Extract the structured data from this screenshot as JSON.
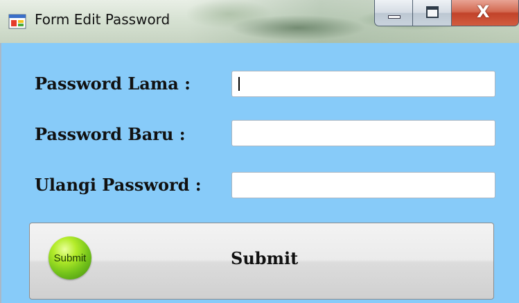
{
  "window": {
    "title": "Form Edit Password",
    "icon": "form-window-icon",
    "controls": {
      "minimize_icon": "minimize-icon",
      "maximize_icon": "maximize-icon",
      "close_label": "X"
    }
  },
  "form": {
    "fields": [
      {
        "label": "Password Lama :",
        "value": ""
      },
      {
        "label": "Password Baru :",
        "value": ""
      },
      {
        "label": "Ulangi Password :",
        "value": ""
      }
    ],
    "submit": {
      "label": "Submit",
      "badge_text": "Submit",
      "badge_icon": "green-submit-badge-icon"
    }
  },
  "colors": {
    "client_background": "#87cbf9",
    "close_button": "#c2432a",
    "badge_green": "#74c31a"
  }
}
